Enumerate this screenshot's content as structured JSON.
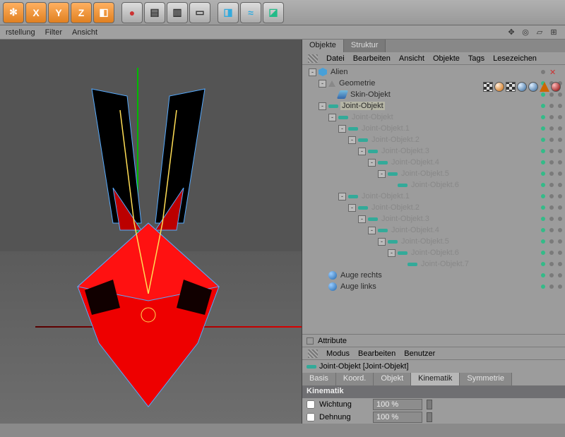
{
  "toolbar": {
    "snap": "✻",
    "axes": [
      "X",
      "Y",
      "Z"
    ],
    "cube": "◧",
    "rec": "●",
    "clap": "▤",
    "clap2": "▥",
    "frame": "▭",
    "prim": "◨",
    "spline": "≈",
    "nurbs": "◪"
  },
  "menubar": {
    "items": [
      "rstellung",
      "Filter",
      "Ansicht"
    ]
  },
  "panel_tabs": [
    "Objekte",
    "Struktur"
  ],
  "panel_menu": [
    "Datei",
    "Bearbeiten",
    "Ansicht",
    "Objekte",
    "Tags",
    "Lesezeichen"
  ],
  "tree": [
    {
      "d": 0,
      "exp": "-",
      "icon": "cube",
      "label": "Alien"
    },
    {
      "d": 1,
      "exp": "-",
      "icon": "tri",
      "label": "Geometrie"
    },
    {
      "d": 2,
      "exp": "",
      "icon": "skin",
      "label": "Skin-Objekt"
    },
    {
      "d": 1,
      "exp": "-",
      "icon": "bone",
      "label": "Joint-Objekt",
      "sel": true
    },
    {
      "d": 2,
      "exp": "-",
      "icon": "bone",
      "label": "Joint-Objekt",
      "dim": true
    },
    {
      "d": 3,
      "exp": "-",
      "icon": "bone",
      "label": "Joint-Objekt.1",
      "dim": true
    },
    {
      "d": 4,
      "exp": "-",
      "icon": "bone",
      "label": "Joint-Objekt.2",
      "dim": true
    },
    {
      "d": 5,
      "exp": "-",
      "icon": "bone",
      "label": "Joint-Objekt.3",
      "dim": true
    },
    {
      "d": 6,
      "exp": "-",
      "icon": "bone",
      "label": "Joint-Objekt.4",
      "dim": true
    },
    {
      "d": 7,
      "exp": "-",
      "icon": "bone",
      "label": "Joint-Objekt.5",
      "dim": true
    },
    {
      "d": 8,
      "exp": "",
      "icon": "bone",
      "label": "Joint-Objekt.6",
      "dim": true
    },
    {
      "d": 3,
      "exp": "-",
      "icon": "bone",
      "label": "Joint-Objekt.1",
      "dim": true
    },
    {
      "d": 4,
      "exp": "-",
      "icon": "bone",
      "label": "Joint-Objekt.2",
      "dim": true
    },
    {
      "d": 5,
      "exp": "-",
      "icon": "bone",
      "label": "Joint-Objekt.3",
      "dim": true
    },
    {
      "d": 6,
      "exp": "-",
      "icon": "bone",
      "label": "Joint-Objekt.4",
      "dim": true
    },
    {
      "d": 7,
      "exp": "-",
      "icon": "bone",
      "label": "Joint-Objekt.5",
      "dim": true
    },
    {
      "d": 8,
      "exp": "-",
      "icon": "bone",
      "label": "Joint-Objekt.6",
      "dim": true
    },
    {
      "d": 9,
      "exp": "",
      "icon": "bone",
      "label": "Joint-Objekt.7",
      "dim": true
    },
    {
      "d": 1,
      "exp": "",
      "icon": "sphere",
      "label": "Auge rechts"
    },
    {
      "d": 1,
      "exp": "",
      "icon": "sphere",
      "label": "Auge links"
    }
  ],
  "close_x": "✕",
  "attr": {
    "title": "Attribute",
    "menu": [
      "Modus",
      "Bearbeiten",
      "Benutzer"
    ],
    "obj_label": "Joint-Objekt [Joint-Objekt]",
    "tabs": [
      "Basis",
      "Koord.",
      "Objekt",
      "Kinematik",
      "Symmetrie"
    ],
    "active_tab": 3,
    "section": "Kinematik",
    "fields": [
      {
        "label": "Wichtung",
        "value": "100 %"
      },
      {
        "label": "Dehnung",
        "value": "100 %"
      }
    ]
  }
}
